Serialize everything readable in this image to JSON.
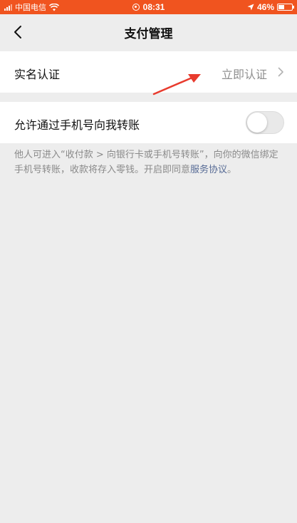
{
  "status_bar": {
    "carrier": "中国电信",
    "time": "08:31",
    "battery": "46%",
    "battery_level": 0.46,
    "background_color": "#f0541f"
  },
  "nav": {
    "back_icon": "chevron-left-icon",
    "title": "支付管理"
  },
  "real_name_cell": {
    "label": "实名认证",
    "value": "立即认证",
    "icon": "chevron-right-icon"
  },
  "transfer_cell": {
    "label": "允许通过手机号向我转账",
    "toggle_on": false
  },
  "note": {
    "text": "他人可进入“收付款 > 向银行卡或手机号转账”，向你的微信绑定手机号转账，收款将存入零钱。开启即同意",
    "link": "服务协议",
    "end": "。",
    "link_color": "#576b95"
  },
  "colors": {
    "background": "#ededed",
    "annotation_arrow": "#e83b2e"
  }
}
